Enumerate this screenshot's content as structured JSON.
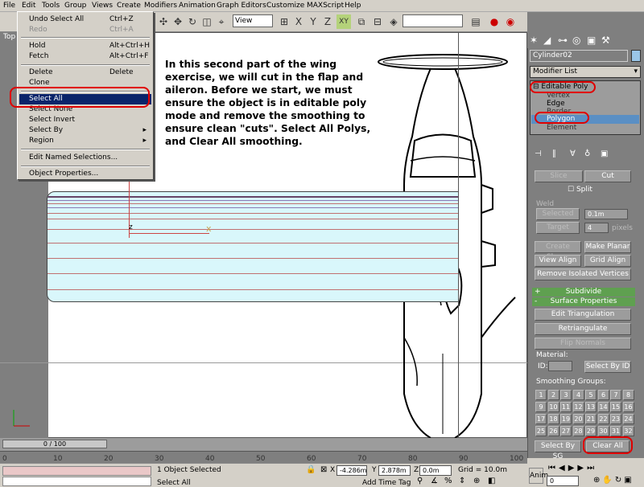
{
  "menubar": [
    "File",
    "Edit",
    "Tools",
    "Group",
    "Views",
    "Create",
    "Modifiers",
    "Animation",
    "Graph Editors",
    "Customize",
    "MAXScript",
    "Help"
  ],
  "viewport": {
    "label": "Top",
    "axis_z": "z",
    "axis_x": "x"
  },
  "view_dropdown": "View",
  "edit_menu": {
    "undo": {
      "label": "Undo Select All",
      "shortcut": "Ctrl+Z"
    },
    "redo": {
      "label": "Redo",
      "shortcut": "Ctrl+A"
    },
    "hold": {
      "label": "Hold",
      "shortcut": "Alt+Ctrl+H"
    },
    "fetch": {
      "label": "Fetch",
      "shortcut": "Alt+Ctrl+F"
    },
    "delete": {
      "label": "Delete",
      "shortcut": "Delete"
    },
    "clone": {
      "label": "Clone"
    },
    "select_all": {
      "label": "Select All"
    },
    "select_none": {
      "label": "Select None"
    },
    "select_invert": {
      "label": "Select Invert"
    },
    "select_by": {
      "label": "Select By"
    },
    "region": {
      "label": "Region"
    },
    "edit_named": {
      "label": "Edit Named Selections..."
    },
    "object_props": {
      "label": "Object Properties..."
    }
  },
  "instruction": "In this second part of the wing exercise, we will cut in the flap and aileron.  Before we start, we must ensure the object is in editable poly mode and remove the smoothing to ensure clean \"cuts\".  Select All Polys, and Clear All smoothing.",
  "panel": {
    "object_name": "Cylinder02",
    "modifier_list": "Modifier List",
    "stack": [
      "Editable Poly",
      "Vertex",
      "Edge",
      "Border",
      "Polygon",
      "Element"
    ],
    "slice": "Slice",
    "cut": "Cut",
    "split": "Split",
    "weld": "Weld",
    "selected": "Selected",
    "selected_val": "0.1m",
    "target": "Target",
    "target_val": "4",
    "pixels": "pixels",
    "create_shape": "Create Shape",
    "make_planar": "Make Planar",
    "view_align": "View Align",
    "grid_align": "Grid Align",
    "remove_isolated": "Remove Isolated Vertices",
    "subdivide": "Subdivide",
    "surface_props": "Surface Properties",
    "edit_tri": "Edit Triangulation",
    "retriangulate": "Retriangulate",
    "flip_normals": "Flip Normals",
    "material": "Material:",
    "id": "ID:",
    "select_by_id": "Select By ID",
    "smoothing_groups": "Smoothing Groups:",
    "sg": [
      "1",
      "2",
      "3",
      "4",
      "5",
      "6",
      "7",
      "8",
      "9",
      "10",
      "11",
      "12",
      "13",
      "14",
      "15",
      "16",
      "17",
      "18",
      "19",
      "20",
      "21",
      "22",
      "23",
      "24",
      "25",
      "26",
      "27",
      "28",
      "29",
      "30",
      "31",
      "32"
    ],
    "select_by_sg": "Select By SG",
    "clear_all": "Clear All"
  },
  "timeline": {
    "slider": "0 / 100",
    "ticks": [
      "0",
      "10",
      "20",
      "30",
      "40",
      "50",
      "60",
      "70",
      "80",
      "90",
      "100"
    ]
  },
  "status": {
    "objects": "1 Object Selected",
    "prompt": "Select All",
    "x": "-4.286m",
    "y": "2.878m",
    "z": "0.0m",
    "grid": "Grid = 10.0m",
    "add_time_tag": "Add Time Tag",
    "anim": "Anim",
    "frame": "0"
  },
  "colors": {
    "highlight": "#0a246a",
    "annotation_red": "#e00000",
    "wing_fill": "#d9f7fb",
    "rollout_header": "#5fa050"
  }
}
